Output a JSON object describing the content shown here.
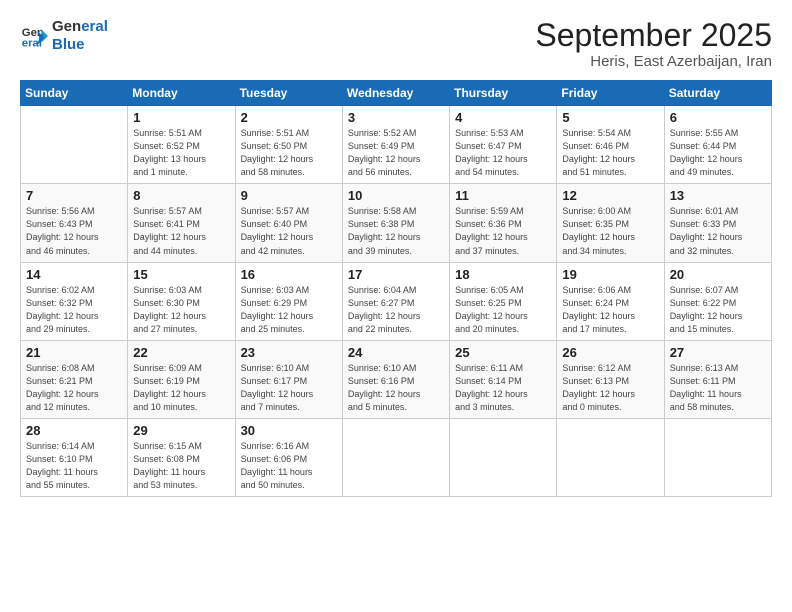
{
  "logo": {
    "line1": "General",
    "line2": "Blue"
  },
  "calendar": {
    "title": "September 2025",
    "subtitle": "Heris, East Azerbaijan, Iran"
  },
  "headers": [
    "Sunday",
    "Monday",
    "Tuesday",
    "Wednesday",
    "Thursday",
    "Friday",
    "Saturday"
  ],
  "weeks": [
    [
      {
        "day": "",
        "info": ""
      },
      {
        "day": "1",
        "info": "Sunrise: 5:51 AM\nSunset: 6:52 PM\nDaylight: 13 hours\nand 1 minute."
      },
      {
        "day": "2",
        "info": "Sunrise: 5:51 AM\nSunset: 6:50 PM\nDaylight: 12 hours\nand 58 minutes."
      },
      {
        "day": "3",
        "info": "Sunrise: 5:52 AM\nSunset: 6:49 PM\nDaylight: 12 hours\nand 56 minutes."
      },
      {
        "day": "4",
        "info": "Sunrise: 5:53 AM\nSunset: 6:47 PM\nDaylight: 12 hours\nand 54 minutes."
      },
      {
        "day": "5",
        "info": "Sunrise: 5:54 AM\nSunset: 6:46 PM\nDaylight: 12 hours\nand 51 minutes."
      },
      {
        "day": "6",
        "info": "Sunrise: 5:55 AM\nSunset: 6:44 PM\nDaylight: 12 hours\nand 49 minutes."
      }
    ],
    [
      {
        "day": "7",
        "info": "Sunrise: 5:56 AM\nSunset: 6:43 PM\nDaylight: 12 hours\nand 46 minutes."
      },
      {
        "day": "8",
        "info": "Sunrise: 5:57 AM\nSunset: 6:41 PM\nDaylight: 12 hours\nand 44 minutes."
      },
      {
        "day": "9",
        "info": "Sunrise: 5:57 AM\nSunset: 6:40 PM\nDaylight: 12 hours\nand 42 minutes."
      },
      {
        "day": "10",
        "info": "Sunrise: 5:58 AM\nSunset: 6:38 PM\nDaylight: 12 hours\nand 39 minutes."
      },
      {
        "day": "11",
        "info": "Sunrise: 5:59 AM\nSunset: 6:36 PM\nDaylight: 12 hours\nand 37 minutes."
      },
      {
        "day": "12",
        "info": "Sunrise: 6:00 AM\nSunset: 6:35 PM\nDaylight: 12 hours\nand 34 minutes."
      },
      {
        "day": "13",
        "info": "Sunrise: 6:01 AM\nSunset: 6:33 PM\nDaylight: 12 hours\nand 32 minutes."
      }
    ],
    [
      {
        "day": "14",
        "info": "Sunrise: 6:02 AM\nSunset: 6:32 PM\nDaylight: 12 hours\nand 29 minutes."
      },
      {
        "day": "15",
        "info": "Sunrise: 6:03 AM\nSunset: 6:30 PM\nDaylight: 12 hours\nand 27 minutes."
      },
      {
        "day": "16",
        "info": "Sunrise: 6:03 AM\nSunset: 6:29 PM\nDaylight: 12 hours\nand 25 minutes."
      },
      {
        "day": "17",
        "info": "Sunrise: 6:04 AM\nSunset: 6:27 PM\nDaylight: 12 hours\nand 22 minutes."
      },
      {
        "day": "18",
        "info": "Sunrise: 6:05 AM\nSunset: 6:25 PM\nDaylight: 12 hours\nand 20 minutes."
      },
      {
        "day": "19",
        "info": "Sunrise: 6:06 AM\nSunset: 6:24 PM\nDaylight: 12 hours\nand 17 minutes."
      },
      {
        "day": "20",
        "info": "Sunrise: 6:07 AM\nSunset: 6:22 PM\nDaylight: 12 hours\nand 15 minutes."
      }
    ],
    [
      {
        "day": "21",
        "info": "Sunrise: 6:08 AM\nSunset: 6:21 PM\nDaylight: 12 hours\nand 12 minutes."
      },
      {
        "day": "22",
        "info": "Sunrise: 6:09 AM\nSunset: 6:19 PM\nDaylight: 12 hours\nand 10 minutes."
      },
      {
        "day": "23",
        "info": "Sunrise: 6:10 AM\nSunset: 6:17 PM\nDaylight: 12 hours\nand 7 minutes."
      },
      {
        "day": "24",
        "info": "Sunrise: 6:10 AM\nSunset: 6:16 PM\nDaylight: 12 hours\nand 5 minutes."
      },
      {
        "day": "25",
        "info": "Sunrise: 6:11 AM\nSunset: 6:14 PM\nDaylight: 12 hours\nand 3 minutes."
      },
      {
        "day": "26",
        "info": "Sunrise: 6:12 AM\nSunset: 6:13 PM\nDaylight: 12 hours\nand 0 minutes."
      },
      {
        "day": "27",
        "info": "Sunrise: 6:13 AM\nSunset: 6:11 PM\nDaylight: 11 hours\nand 58 minutes."
      }
    ],
    [
      {
        "day": "28",
        "info": "Sunrise: 6:14 AM\nSunset: 6:10 PM\nDaylight: 11 hours\nand 55 minutes."
      },
      {
        "day": "29",
        "info": "Sunrise: 6:15 AM\nSunset: 6:08 PM\nDaylight: 11 hours\nand 53 minutes."
      },
      {
        "day": "30",
        "info": "Sunrise: 6:16 AM\nSunset: 6:06 PM\nDaylight: 11 hours\nand 50 minutes."
      },
      {
        "day": "",
        "info": ""
      },
      {
        "day": "",
        "info": ""
      },
      {
        "day": "",
        "info": ""
      },
      {
        "day": "",
        "info": ""
      }
    ]
  ]
}
